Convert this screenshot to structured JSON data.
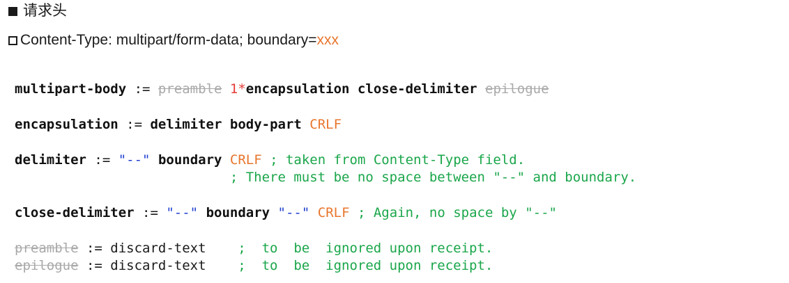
{
  "heading": {
    "title": "请求头",
    "content_type_prefix": "Content-Type: multipart/form-data; boundary=",
    "content_type_value": "xxx"
  },
  "grammar": {
    "line1": {
      "name": "multipart-body",
      "op": " := ",
      "preamble": "preamble",
      "sp1": " ",
      "count": "1*",
      "encapsulation": "encapsulation",
      "sp2": " ",
      "close_delimiter": "close-delimiter",
      "sp3": " ",
      "epilogue": "epilogue"
    },
    "line2": {
      "name": "encapsulation",
      "op": " := ",
      "delimiter": "delimiter",
      "sp1": " ",
      "body_part": "body-part",
      "sp2": " ",
      "crlf": "CRLF"
    },
    "line3": {
      "name": "delimiter",
      "op": " := ",
      "dashes": "\"--\"",
      "sp1": " ",
      "boundary": "boundary",
      "sp2": " ",
      "crlf": "CRLF",
      "comment": " ; taken from Content-Type field."
    },
    "line3b": {
      "indent": "                           ",
      "comment": "; There must be no space between \"--\" and boundary."
    },
    "line4": {
      "name": "close-delimiter",
      "op": " := ",
      "dashes1": "\"--\"",
      "sp1": " ",
      "boundary": "boundary",
      "sp2": " ",
      "dashes2": "\"--\"",
      "sp3": " ",
      "crlf": "CRLF",
      "comment": " ; Again, no space by \"--\""
    },
    "line5": {
      "name": "preamble",
      "rest": " := discard-text   ",
      "comment": " ;  to  be  ignored upon receipt."
    },
    "line6": {
      "name": "epilogue",
      "rest": " := discard-text   ",
      "comment": " ;  to  be  ignored upon receipt."
    }
  }
}
